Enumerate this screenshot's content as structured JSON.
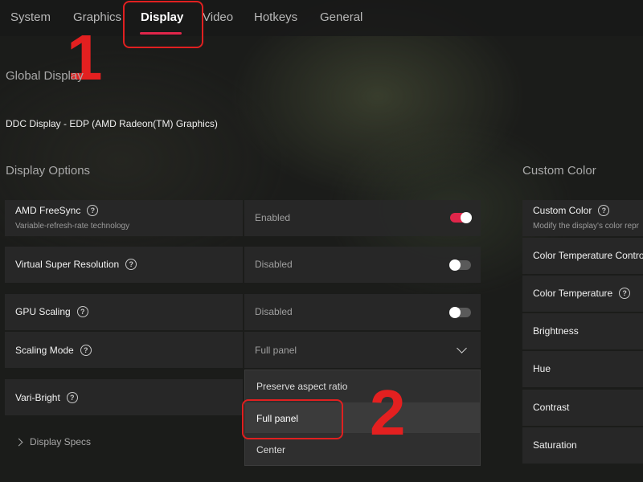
{
  "tabs": [
    {
      "label": "System"
    },
    {
      "label": "Graphics"
    },
    {
      "label": "Display",
      "active": true
    },
    {
      "label": "Video"
    },
    {
      "label": "Hotkeys"
    },
    {
      "label": "General"
    }
  ],
  "annotations": {
    "step1": "1",
    "step2": "2",
    "color": "#e32020"
  },
  "accent_color": "#e0264a",
  "global_display": {
    "title": "Global Display",
    "device": "DDC Display - EDP (AMD Radeon(TM) Graphics)"
  },
  "display_options": {
    "title": "Display Options",
    "rows": [
      {
        "label": "AMD FreeSync",
        "sublabel": "Variable-refresh-rate technology",
        "value": "Enabled",
        "toggle": "on",
        "icon": "help-icon"
      },
      {
        "label": "Virtual Super Resolution",
        "value": "Disabled",
        "toggle": "off",
        "icon": "help-icon"
      },
      {
        "label": "GPU Scaling",
        "value": "Disabled",
        "toggle": "off",
        "icon": "help-icon"
      },
      {
        "label": "Scaling Mode",
        "value": "Full panel",
        "icon": "help-icon"
      },
      {
        "label": "Vari-Bright",
        "icon": "help-icon"
      }
    ],
    "scaling_mode_options": [
      "Preserve aspect ratio",
      "Full panel",
      "Center"
    ],
    "scaling_mode_selected": "Full panel"
  },
  "display_specs": {
    "label": "Display Specs"
  },
  "custom_color": {
    "title": "Custom Color",
    "rows": [
      {
        "label": "Custom Color",
        "sublabel": "Modify the display's color repr",
        "icon": "help-icon"
      },
      {
        "label": "Color Temperature Contro"
      },
      {
        "label": "Color Temperature",
        "icon": "help-icon"
      },
      {
        "label": "Brightness"
      },
      {
        "label": "Hue"
      },
      {
        "label": "Contrast"
      },
      {
        "label": "Saturation"
      }
    ]
  },
  "icons": {
    "help": "?",
    "help_name": "help-icon",
    "chevron_down": "chevron-down-icon",
    "chevron_right": "chevron-right-icon"
  }
}
